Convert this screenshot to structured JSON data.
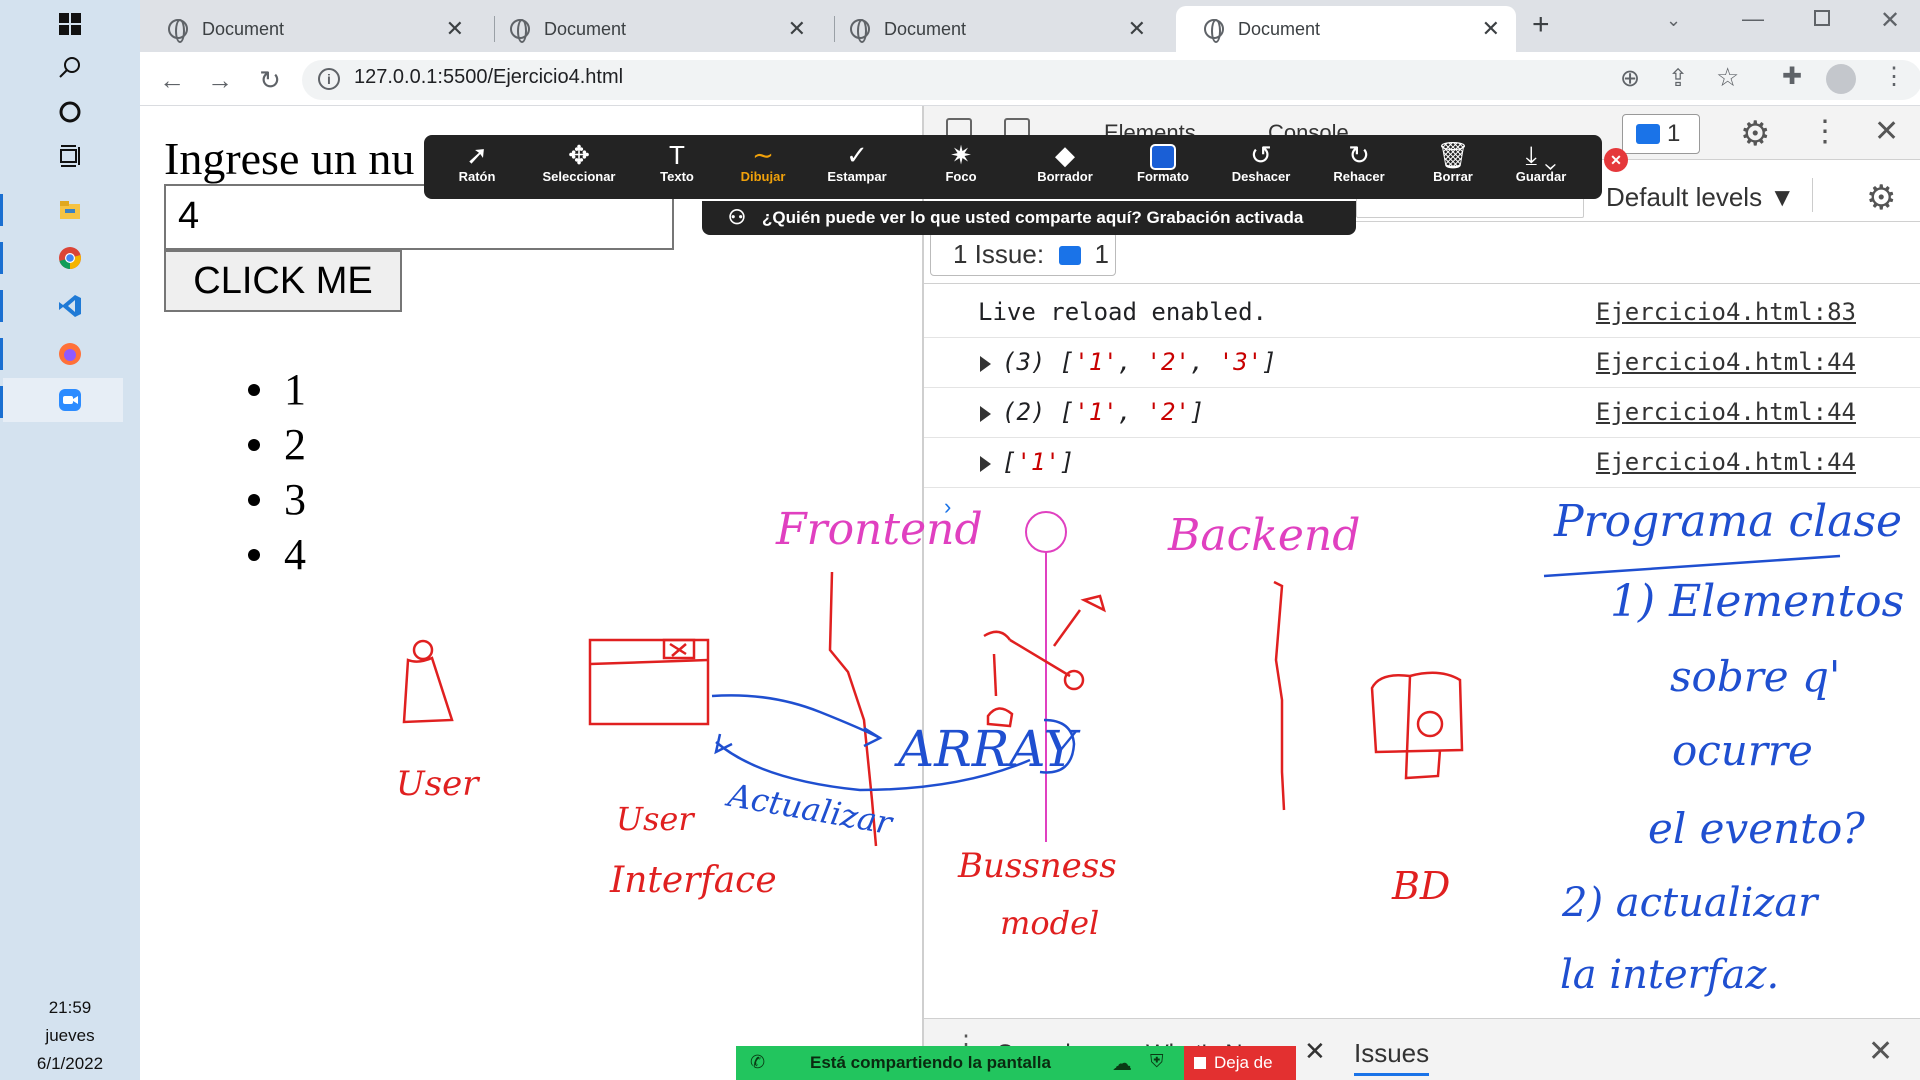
{
  "taskbar": {
    "icons": [
      "windows-start-icon",
      "search-icon",
      "cortana-icon",
      "task-view-icon",
      "file-explorer-icon",
      "chrome-icon",
      "vscode-icon",
      "firefox-icon",
      "zoom-icon"
    ],
    "time": "21:59",
    "day": "jueves",
    "date": "6/1/2022"
  },
  "browser": {
    "tabs": [
      {
        "label": "Document"
      },
      {
        "label": "Document"
      },
      {
        "label": "Document"
      },
      {
        "label": "Document"
      }
    ],
    "new_tab": "+",
    "url": "127.0.0.1:5500/Ejercicio4.html"
  },
  "page": {
    "prompt": "Ingrese un nu",
    "input_value": "4",
    "button_label": "CLICK ME",
    "list": [
      "1",
      "2",
      "3",
      "4"
    ]
  },
  "devtools": {
    "tab_elements": "Elements",
    "tab_console": "Console",
    "issues_badge": "1",
    "levels": "Default levels",
    "issues_bar_label": "1 Issue:",
    "issues_bar_count": "1",
    "console": [
      {
        "msg": "Live reload enabled.",
        "src": "Ejercicio4.html:83",
        "expandable": false
      },
      {
        "prefix": "(3) [",
        "items": [
          "'1'",
          "'2'",
          "'3'"
        ],
        "suffix": "]",
        "src": "Ejercicio4.html:44",
        "expandable": true
      },
      {
        "prefix": "(2) [",
        "items": [
          "'1'",
          "'2'"
        ],
        "suffix": "]",
        "src": "Ejercicio4.html:44",
        "expandable": true
      },
      {
        "prefix": "[",
        "items": [
          "'1'"
        ],
        "suffix": "]",
        "src": "Ejercicio4.html:44",
        "expandable": true
      }
    ],
    "drawer_tabs": [
      "Console",
      "What's New",
      "Issues"
    ],
    "drawer_issues": "Issues"
  },
  "zoom_toolbar": {
    "tools": [
      {
        "label": "Ratón",
        "icon": "mouse-pointer-icon"
      },
      {
        "label": "Seleccionar",
        "icon": "move-icon"
      },
      {
        "label": "Texto",
        "icon": "text-icon"
      },
      {
        "label": "Dibujar",
        "icon": "draw-icon",
        "active": true
      },
      {
        "label": "Estampar",
        "icon": "stamp-check-icon"
      },
      {
        "label": "Foco",
        "icon": "spotlight-icon"
      },
      {
        "label": "Borrador",
        "icon": "eraser-icon"
      },
      {
        "label": "Formato",
        "icon": "format-icon"
      },
      {
        "label": "Deshacer",
        "icon": "undo-icon"
      },
      {
        "label": "Rehacer",
        "icon": "redo-icon"
      },
      {
        "label": "Borrar",
        "icon": "trash-icon"
      },
      {
        "label": "Guardar",
        "icon": "save-icon"
      }
    ],
    "notice": "¿Quién puede ver lo que usted comparte aquí? Grabación activada",
    "accent": "#f0a10a",
    "format_color": "#1a5fd6"
  },
  "share_bar": {
    "label": "Está compartiendo la pantalla",
    "stop": "Deja de"
  },
  "annotations": {
    "frontend": "Frontend",
    "backend": "Backend",
    "user": "User",
    "user_interface_1": "User",
    "user_interface_2": "Interface",
    "array": "ARRAY",
    "actualizar": "Actualizar",
    "business_1": "Bussness",
    "business_2": "model",
    "bd": "BD",
    "notes": [
      "Programa clase",
      "1) Elementos",
      "sobre q'",
      "ocurre",
      "el evento?",
      "2) actualizar",
      "la interfaz."
    ],
    "colors": {
      "pink": "#e040c0",
      "red": "#e02020",
      "blue": "#1f4fd0"
    }
  }
}
